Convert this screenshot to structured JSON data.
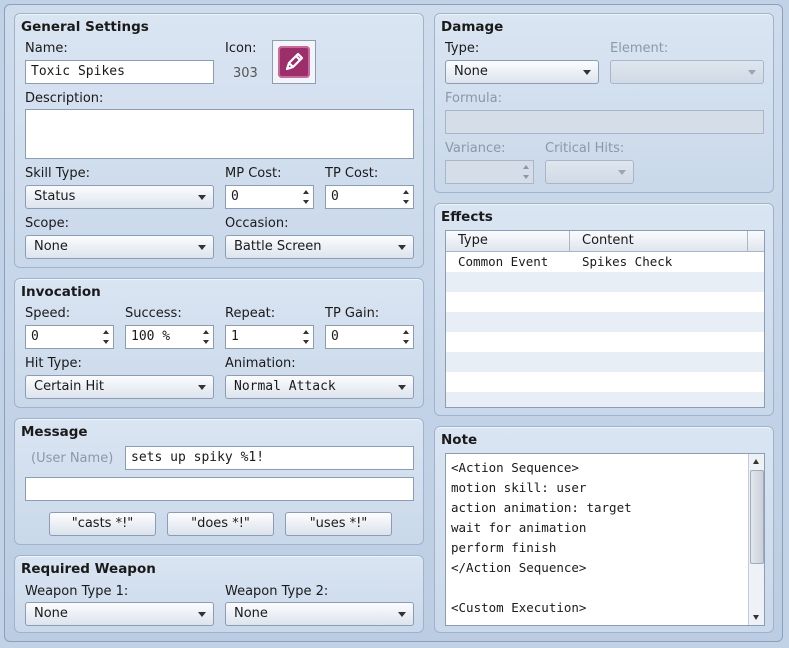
{
  "general": {
    "title": "General Settings",
    "name_label": "Name:",
    "name_value": "Toxic Spikes",
    "icon_label": "Icon:",
    "icon_index": "303",
    "icon_name": "pencil-icon",
    "icon_color": "#9c2f6a",
    "description_label": "Description:",
    "description_value": "",
    "skill_type_label": "Skill Type:",
    "skill_type_value": "Status",
    "mp_cost_label": "MP Cost:",
    "mp_cost_value": "0",
    "tp_cost_label": "TP Cost:",
    "tp_cost_value": "0",
    "scope_label": "Scope:",
    "scope_value": "None",
    "occasion_label": "Occasion:",
    "occasion_value": "Battle Screen"
  },
  "invocation": {
    "title": "Invocation",
    "speed_label": "Speed:",
    "speed_value": "0",
    "success_label": "Success:",
    "success_value": "100 %",
    "repeat_label": "Repeat:",
    "repeat_value": "1",
    "tp_gain_label": "TP Gain:",
    "tp_gain_value": "0",
    "hit_type_label": "Hit Type:",
    "hit_type_value": "Certain Hit",
    "animation_label": "Animation:",
    "animation_value": "Normal Attack"
  },
  "message": {
    "title": "Message",
    "user_name_label": "(User Name)",
    "line1_value": "sets up spiky %1!",
    "line2_value": "",
    "btn_casts": "\"casts *!\"",
    "btn_does": "\"does *!\"",
    "btn_uses": "\"uses *!\""
  },
  "weapon": {
    "title": "Required Weapon",
    "type1_label": "Weapon Type 1:",
    "type1_value": "None",
    "type2_label": "Weapon Type 2:",
    "type2_value": "None"
  },
  "damage": {
    "title": "Damage",
    "type_label": "Type:",
    "type_value": "None",
    "element_label": "Element:",
    "element_value": "",
    "formula_label": "Formula:",
    "formula_value": "",
    "variance_label": "Variance:",
    "variance_value": "",
    "critical_label": "Critical Hits:",
    "critical_value": ""
  },
  "effects": {
    "title": "Effects",
    "col_type": "Type",
    "col_content": "Content",
    "rows": [
      {
        "type": "Common Event",
        "content": "Spikes Check"
      }
    ]
  },
  "note": {
    "title": "Note",
    "lines": [
      "<Action Sequence>",
      "motion skill: user",
      "action animation: target",
      "wait for animation",
      "perform finish",
      "</Action Sequence>",
      "",
      "<Custom Execution>"
    ]
  }
}
